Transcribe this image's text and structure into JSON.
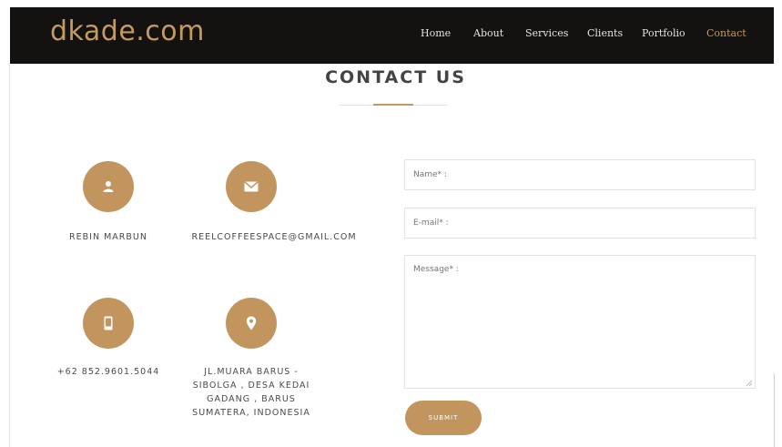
{
  "brand": {
    "logo_text": "dkade.com",
    "accent": "#c49a5e",
    "nav_bg": "#141210"
  },
  "nav": {
    "items": [
      {
        "label": "Home",
        "active": false
      },
      {
        "label": "About",
        "active": false
      },
      {
        "label": "Services",
        "active": false
      },
      {
        "label": "Clients",
        "active": false
      },
      {
        "label": "Portfolio",
        "active": false
      },
      {
        "label": "Contact",
        "active": true
      }
    ]
  },
  "section": {
    "title": "CONTACT US"
  },
  "contacts": {
    "name": {
      "icon": "user-icon",
      "text": "REBIN MARBUN"
    },
    "email": {
      "icon": "envelope-icon",
      "text": "REELCOFFEESPACE@GMAIL.COM"
    },
    "phone": {
      "icon": "mobile-phone-icon",
      "text": "+62 852.9601.5044"
    },
    "address": {
      "icon": "map-marker-icon",
      "lines": [
        "JL.MUARA BARUS -",
        "SIBOLGA , DESA KEDAI",
        "GADANG , BARUS",
        "SUMATERA, INDONESIA"
      ]
    }
  },
  "form": {
    "name_placeholder": "Name* :",
    "email_placeholder": "E-mail* :",
    "message_placeholder": "Message* :",
    "submit_label": "SUBMIT"
  }
}
